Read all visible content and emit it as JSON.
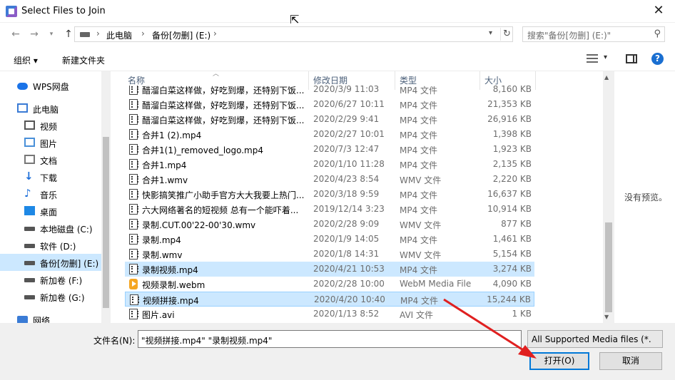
{
  "window": {
    "title": "Select Files to Join",
    "close_label": "✕"
  },
  "nav": {
    "breadcrumb": [
      "此电脑",
      "备份[勿删] (E:)"
    ],
    "search_placeholder": "搜索\"备份[勿删] (E:)\""
  },
  "toolbar": {
    "organize": "组织 ▾",
    "new_folder": "新建文件夹"
  },
  "sidebar": {
    "items": [
      {
        "label": "WPS网盘",
        "icon": "cloud-icon",
        "color": "#1a73e8"
      },
      {
        "label": "此电脑",
        "icon": "computer-icon",
        "color": "#3a7bd5"
      },
      {
        "label": "视频",
        "icon": "video-folder-icon",
        "color": "#555555"
      },
      {
        "label": "图片",
        "icon": "picture-folder-icon",
        "color": "#4a90d9"
      },
      {
        "label": "文档",
        "icon": "document-folder-icon",
        "color": "#777777"
      },
      {
        "label": "下载",
        "icon": "download-icon",
        "color": "#1e6fd9"
      },
      {
        "label": "音乐",
        "icon": "music-icon",
        "color": "#1e6fd9"
      },
      {
        "label": "桌面",
        "icon": "desktop-icon",
        "color": "#1e88e5"
      },
      {
        "label": "本地磁盘 (C:)",
        "icon": "windows-drive-icon",
        "color": "#555555"
      },
      {
        "label": "软件 (D:)",
        "icon": "drive-icon",
        "color": "#555555"
      },
      {
        "label": "备份[勿删] (E:)",
        "icon": "drive-icon",
        "color": "#555555",
        "selected": true
      },
      {
        "label": "新加卷 (F:)",
        "icon": "drive-icon",
        "color": "#555555"
      },
      {
        "label": "新加卷 (G:)",
        "icon": "drive-icon",
        "color": "#555555"
      },
      {
        "label": "网络",
        "icon": "network-icon",
        "color": "#3a7bd5"
      }
    ]
  },
  "columns": {
    "name": "名称",
    "date": "修改日期",
    "type": "类型",
    "size": "大小"
  },
  "files": [
    {
      "name": "醋溜白菜这样做，好吃到爆，还特别下饭...",
      "date": "2020/3/9 11:03",
      "type": "MP4 文件",
      "size": "8,160 KB",
      "kind": "video"
    },
    {
      "name": "醋溜白菜这样做，好吃到爆，还特别下饭...",
      "date": "2020/6/27 10:11",
      "type": "MP4 文件",
      "size": "21,353 KB",
      "kind": "video"
    },
    {
      "name": "醋溜白菜这样做，好吃到爆，还特别下饭...",
      "date": "2020/2/29 9:41",
      "type": "MP4 文件",
      "size": "26,916 KB",
      "kind": "video"
    },
    {
      "name": "合并1 (2).mp4",
      "date": "2020/2/27 10:01",
      "type": "MP4 文件",
      "size": "1,398 KB",
      "kind": "video"
    },
    {
      "name": "合并1(1)_removed_logo.mp4",
      "date": "2020/7/3 12:47",
      "type": "MP4 文件",
      "size": "1,923 KB",
      "kind": "video"
    },
    {
      "name": "合并1.mp4",
      "date": "2020/1/10 11:28",
      "type": "MP4 文件",
      "size": "2,135 KB",
      "kind": "video"
    },
    {
      "name": "合并1.wmv",
      "date": "2020/4/23 8:54",
      "type": "WMV 文件",
      "size": "2,220 KB",
      "kind": "video"
    },
    {
      "name": "快影搞笑推广小助手官方大大我要上热门...",
      "date": "2020/3/18 9:59",
      "type": "MP4 文件",
      "size": "16,637 KB",
      "kind": "video"
    },
    {
      "name": "六大网络著名的短视频 总有一个能吓着...",
      "date": "2019/12/14 3:23",
      "type": "MP4 文件",
      "size": "10,914 KB",
      "kind": "video"
    },
    {
      "name": "录制.CUT.00'22-00'30.wmv",
      "date": "2020/2/28 9:09",
      "type": "WMV 文件",
      "size": "877 KB",
      "kind": "video"
    },
    {
      "name": "录制.mp4",
      "date": "2020/1/9 14:05",
      "type": "MP4 文件",
      "size": "1,461 KB",
      "kind": "video"
    },
    {
      "name": "录制.wmv",
      "date": "2020/1/8 14:31",
      "type": "WMV 文件",
      "size": "5,154 KB",
      "kind": "video"
    },
    {
      "name": "录制视频.mp4",
      "date": "2020/4/21 10:53",
      "type": "MP4 文件",
      "size": "3,274 KB",
      "kind": "video",
      "selected": true
    },
    {
      "name": "视频录制.webm",
      "date": "2020/2/28 10:00",
      "type": "WebM Media File",
      "size": "4,090 KB",
      "kind": "webm"
    },
    {
      "name": "视频拼接.mp4",
      "date": "2020/4/20 10:40",
      "type": "MP4 文件",
      "size": "15,244 KB",
      "kind": "video",
      "selected": true,
      "focused": true
    },
    {
      "name": "图片.avi",
      "date": "2020/1/13 8:52",
      "type": "AVI 文件",
      "size": "1 KB",
      "kind": "video"
    }
  ],
  "preview": {
    "empty_text": "没有预览。"
  },
  "footer": {
    "filename_label": "文件名(N):",
    "filename_value": "\"视频拼接.mp4\" \"录制视频.mp4\"",
    "filter_value": "All Supported Media files (*.",
    "open_label": "打开(O)",
    "cancel_label": "取消"
  },
  "colors": {
    "selection": "#cce8ff",
    "accent": "#0078d7",
    "annotation_arrow": "#e02020"
  }
}
